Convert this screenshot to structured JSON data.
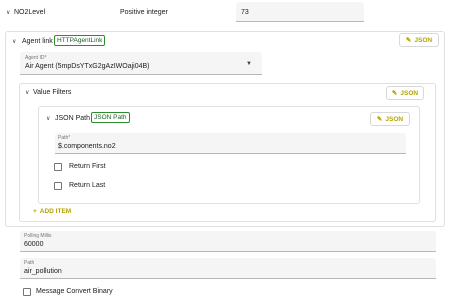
{
  "no2level": {
    "label": "NO2Level",
    "type": "Positive integer",
    "value": "73"
  },
  "agent_link": {
    "label": "Agent link",
    "chip": "HTTPAgentLink",
    "json_button": "JSON",
    "agent_id": {
      "label": "Agent ID*",
      "value": "Air Agent (5mpDsYTxG2gAzIWOaji04B)"
    },
    "value_filters": {
      "label": "Value Filters",
      "json_button": "JSON",
      "json_path": {
        "label": "JSON Path",
        "chip": "JSON Path",
        "json_button": "JSON",
        "path_label": "Path*",
        "path_value": "$.components.no2",
        "return_first": "Return First",
        "return_last": "Return Last"
      },
      "add_item": "ADD ITEM"
    }
  },
  "polling_millis": {
    "label": "Polling Millis",
    "value": "60000"
  },
  "path": {
    "label": "Path",
    "value": "air_pollution"
  },
  "message_convert_binary": "Message Convert Binary",
  "colors": {
    "accent": "#b5a300",
    "chip_border": "#2e8b2e",
    "field_bg": "#f5f5f5"
  }
}
